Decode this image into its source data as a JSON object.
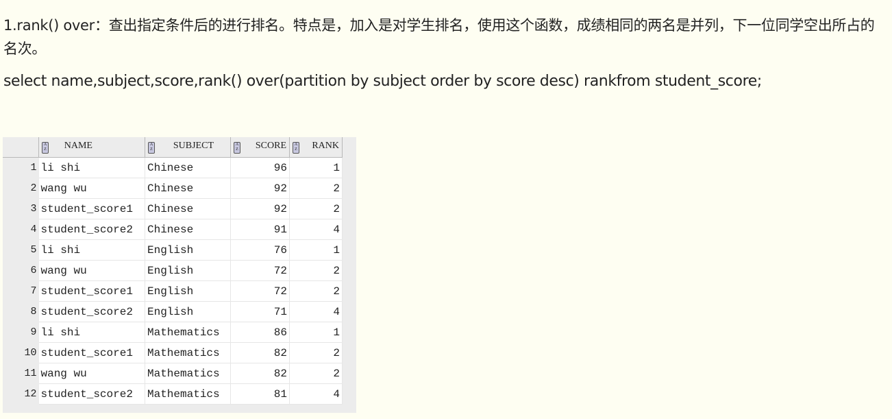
{
  "paragraph1": "1.rank() over：查出指定条件后的进行排名。特点是，加入是对学生排名，使用这个函数，成绩相同的两名是并列，下一位同学空出所占的名次。",
  "paragraph2": "select name,subject,score,rank() over(partition by subject order by score desc) rankfrom student_score;",
  "table": {
    "headers": [
      "NAME",
      "SUBJECT",
      "SCORE",
      "RANK"
    ],
    "sort_icon": "AZ",
    "rows": [
      [
        "1",
        "li shi",
        "Chinese",
        "96",
        "1"
      ],
      [
        "2",
        "wang wu",
        "Chinese",
        "92",
        "2"
      ],
      [
        "3",
        "student_score1",
        "Chinese",
        "92",
        "2"
      ],
      [
        "4",
        "student_score2",
        "Chinese",
        "91",
        "4"
      ],
      [
        "5",
        "li shi",
        "English",
        "76",
        "1"
      ],
      [
        "6",
        "wang wu",
        "English",
        "72",
        "2"
      ],
      [
        "7",
        "student_score1",
        "English",
        "72",
        "2"
      ],
      [
        "8",
        "student_score2",
        "English",
        "71",
        "4"
      ],
      [
        "9",
        "li shi",
        "Mathematics",
        "86",
        "1"
      ],
      [
        "10",
        "student_score1",
        "Mathematics",
        "82",
        "2"
      ],
      [
        "11",
        "wang wu",
        "Mathematics",
        "82",
        "2"
      ],
      [
        "12",
        "student_score2",
        "Mathematics",
        "81",
        "4"
      ]
    ]
  }
}
